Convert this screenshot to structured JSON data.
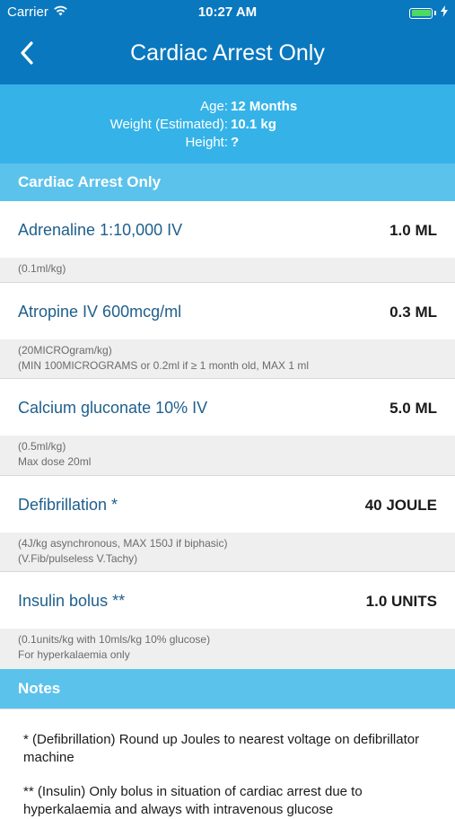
{
  "status_bar": {
    "carrier": "Carrier",
    "time": "10:27 AM",
    "battery_level": 1.0,
    "icons": [
      "wifi-icon",
      "battery-icon",
      "charging-icon"
    ]
  },
  "nav": {
    "back_icon": "chevron-left-icon",
    "title": "Cardiac Arrest Only"
  },
  "patient": {
    "age_label": "Age:",
    "age_value": "12 Months",
    "weight_label": "Weight (Estimated):",
    "weight_value": "10.1 kg",
    "height_label": "Height:",
    "height_value": "?"
  },
  "sections": {
    "cardiac_header": "Cardiac Arrest Only",
    "notes_header": "Notes"
  },
  "drugs": [
    {
      "name": "Adrenaline 1:10,000 IV",
      "dose": "1.0 ML",
      "notes": [
        "(0.1ml/kg)"
      ]
    },
    {
      "name": "Atropine IV 600mcg/ml",
      "dose": "0.3 ML",
      "notes": [
        "(20MICROgram/kg)",
        "(MIN 100MICROGRAMS or 0.2ml if ≥ 1 month old, MAX 1 ml"
      ]
    },
    {
      "name": "Calcium gluconate 10% IV",
      "dose": "5.0 ML",
      "notes": [
        "(0.5ml/kg)",
        "Max dose 20ml"
      ]
    },
    {
      "name": "Defibrillation *",
      "dose": "40 JOULE",
      "notes": [
        "(4J/kg asynchronous, MAX 150J if biphasic)",
        "(V.Fib/pulseless V.Tachy)"
      ]
    },
    {
      "name": "Insulin bolus **",
      "dose": "1.0 UNITS",
      "notes": [
        "(0.1units/kg with 10mls/kg 10% glucose)",
        "For hyperkalaemia only"
      ]
    }
  ],
  "notes": [
    "* (Defibrillation) Round up Joules to nearest voltage on defibrillator machine",
    "** (Insulin) Only bolus in situation of cardiac arrest due to hyperkalaemia and always with intravenous glucose"
  ],
  "colors": {
    "nav_bg": "#0a78be",
    "patient_bg": "#35b3e8",
    "section_bg": "#5bc2ec",
    "drug_name": "#1e5f8c",
    "note_bg": "#efefef"
  }
}
